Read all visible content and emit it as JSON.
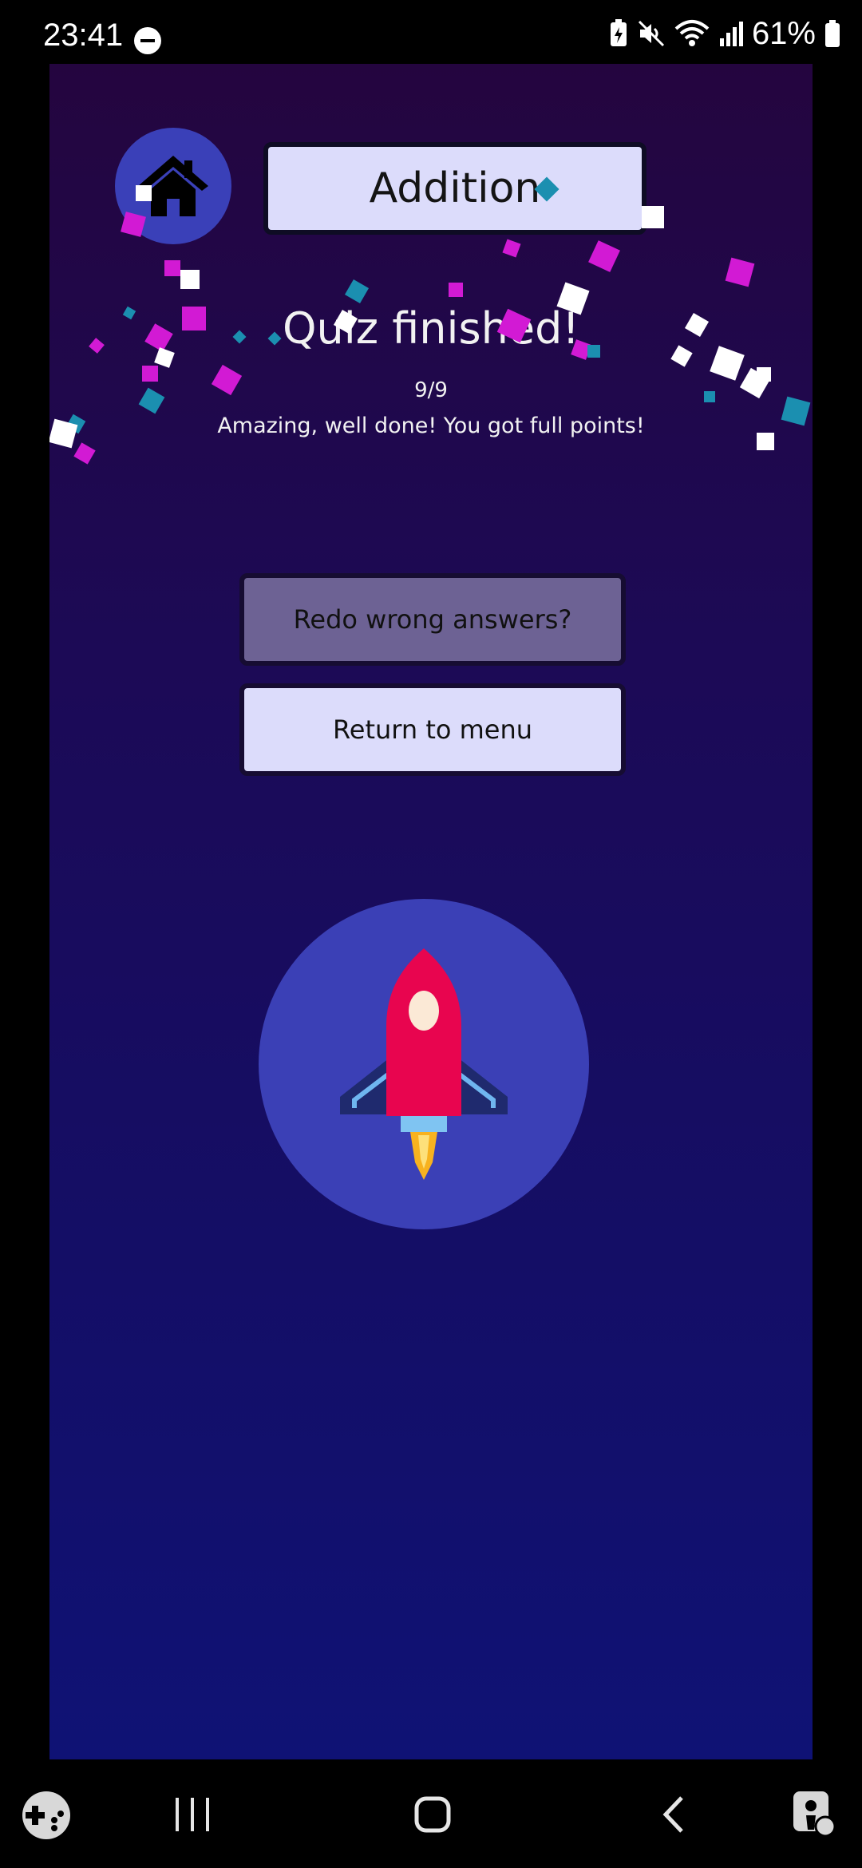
{
  "status_bar": {
    "time": "23:41",
    "battery_percent": "61%",
    "icons": [
      "dnd-icon",
      "battery-saver-icon",
      "mute-icon",
      "wifi-icon",
      "signal-icon",
      "battery-icon"
    ]
  },
  "header": {
    "home_icon": "home-icon",
    "title": "Addition"
  },
  "result": {
    "heading": "Quiz finished!",
    "score": "9/9",
    "message": "Amazing, well done! You got full points!"
  },
  "buttons": {
    "redo_label": "Redo wrong answers?",
    "return_label": "Return to menu"
  },
  "illustration": {
    "icon": "rocket-icon"
  },
  "nav_bar": {
    "icons": [
      "game-launcher-icon",
      "recent-apps-icon",
      "home-nav-icon",
      "back-icon",
      "accessibility-icon"
    ]
  },
  "colors": {
    "background_top": "#24053f",
    "background_bottom": "#0f1275",
    "accent_circle": "#3a40b8",
    "button_light": "#dcdcfb",
    "button_muted": "#6d6294",
    "confetti_magenta": "#d21ad4",
    "confetti_teal": "#1b8fb0",
    "confetti_white": "#ffffff"
  }
}
